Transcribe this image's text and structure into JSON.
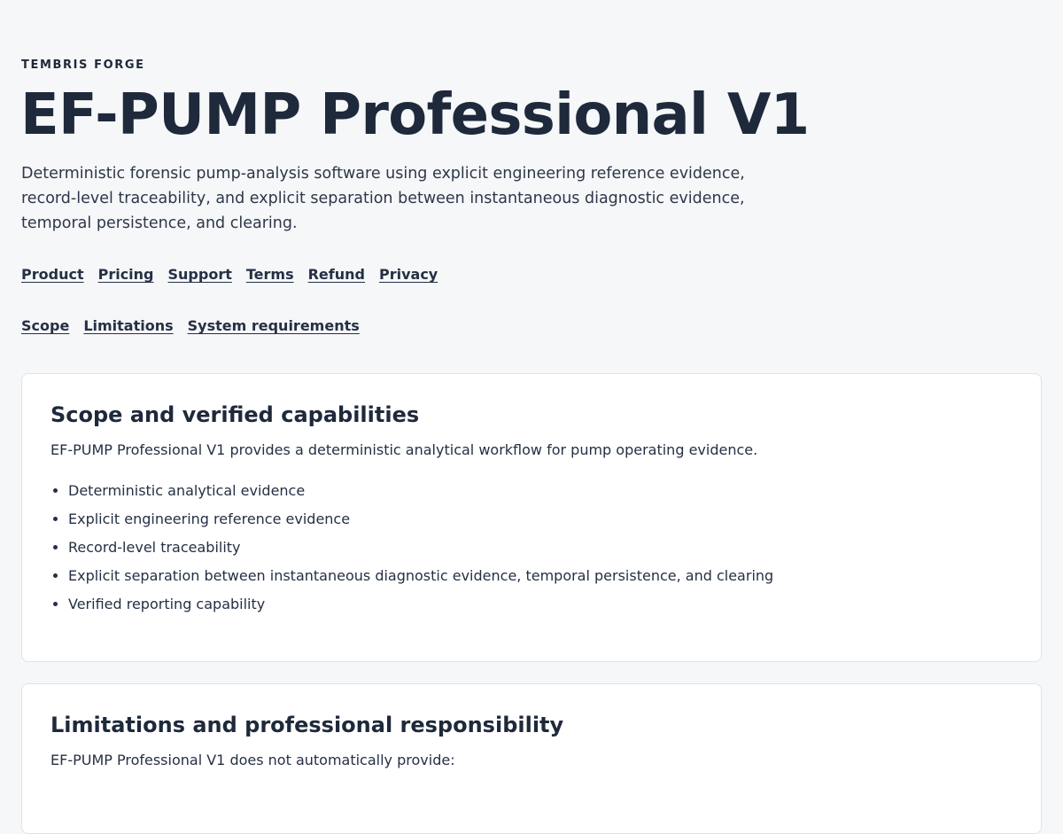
{
  "brand": "TEMBRIS FORGE",
  "title": "EF-PUMP Professional V1",
  "intro": "Deterministic forensic pump-analysis software using explicit engineering reference evidence, record-level traceability, and explicit separation between instantaneous diagnostic evidence, temporal persistence, and clearing.",
  "nav_primary": {
    "product": "Product",
    "pricing": "Pricing",
    "support": "Support",
    "terms": "Terms",
    "refund": "Refund",
    "privacy": "Privacy"
  },
  "nav_secondary": {
    "scope": "Scope",
    "limitations": "Limitations",
    "system_requirements": "System requirements"
  },
  "scope_card": {
    "heading": "Scope and verified capabilities",
    "description": "EF-PUMP Professional V1 provides a deterministic analytical workflow for pump operating evidence.",
    "items": [
      "Deterministic analytical evidence",
      "Explicit engineering reference evidence",
      "Record-level traceability",
      "Explicit separation between instantaneous diagnostic evidence, temporal persistence, and clearing",
      "Verified reporting capability"
    ]
  },
  "limitations_card": {
    "heading": "Limitations and professional responsibility",
    "description": "EF-PUMP Professional V1 does not automatically provide:"
  },
  "colors": {
    "background": "#f6f7f9",
    "text": "#1f2937",
    "card_background": "#ffffff",
    "card_border": "#dfe4ea"
  }
}
